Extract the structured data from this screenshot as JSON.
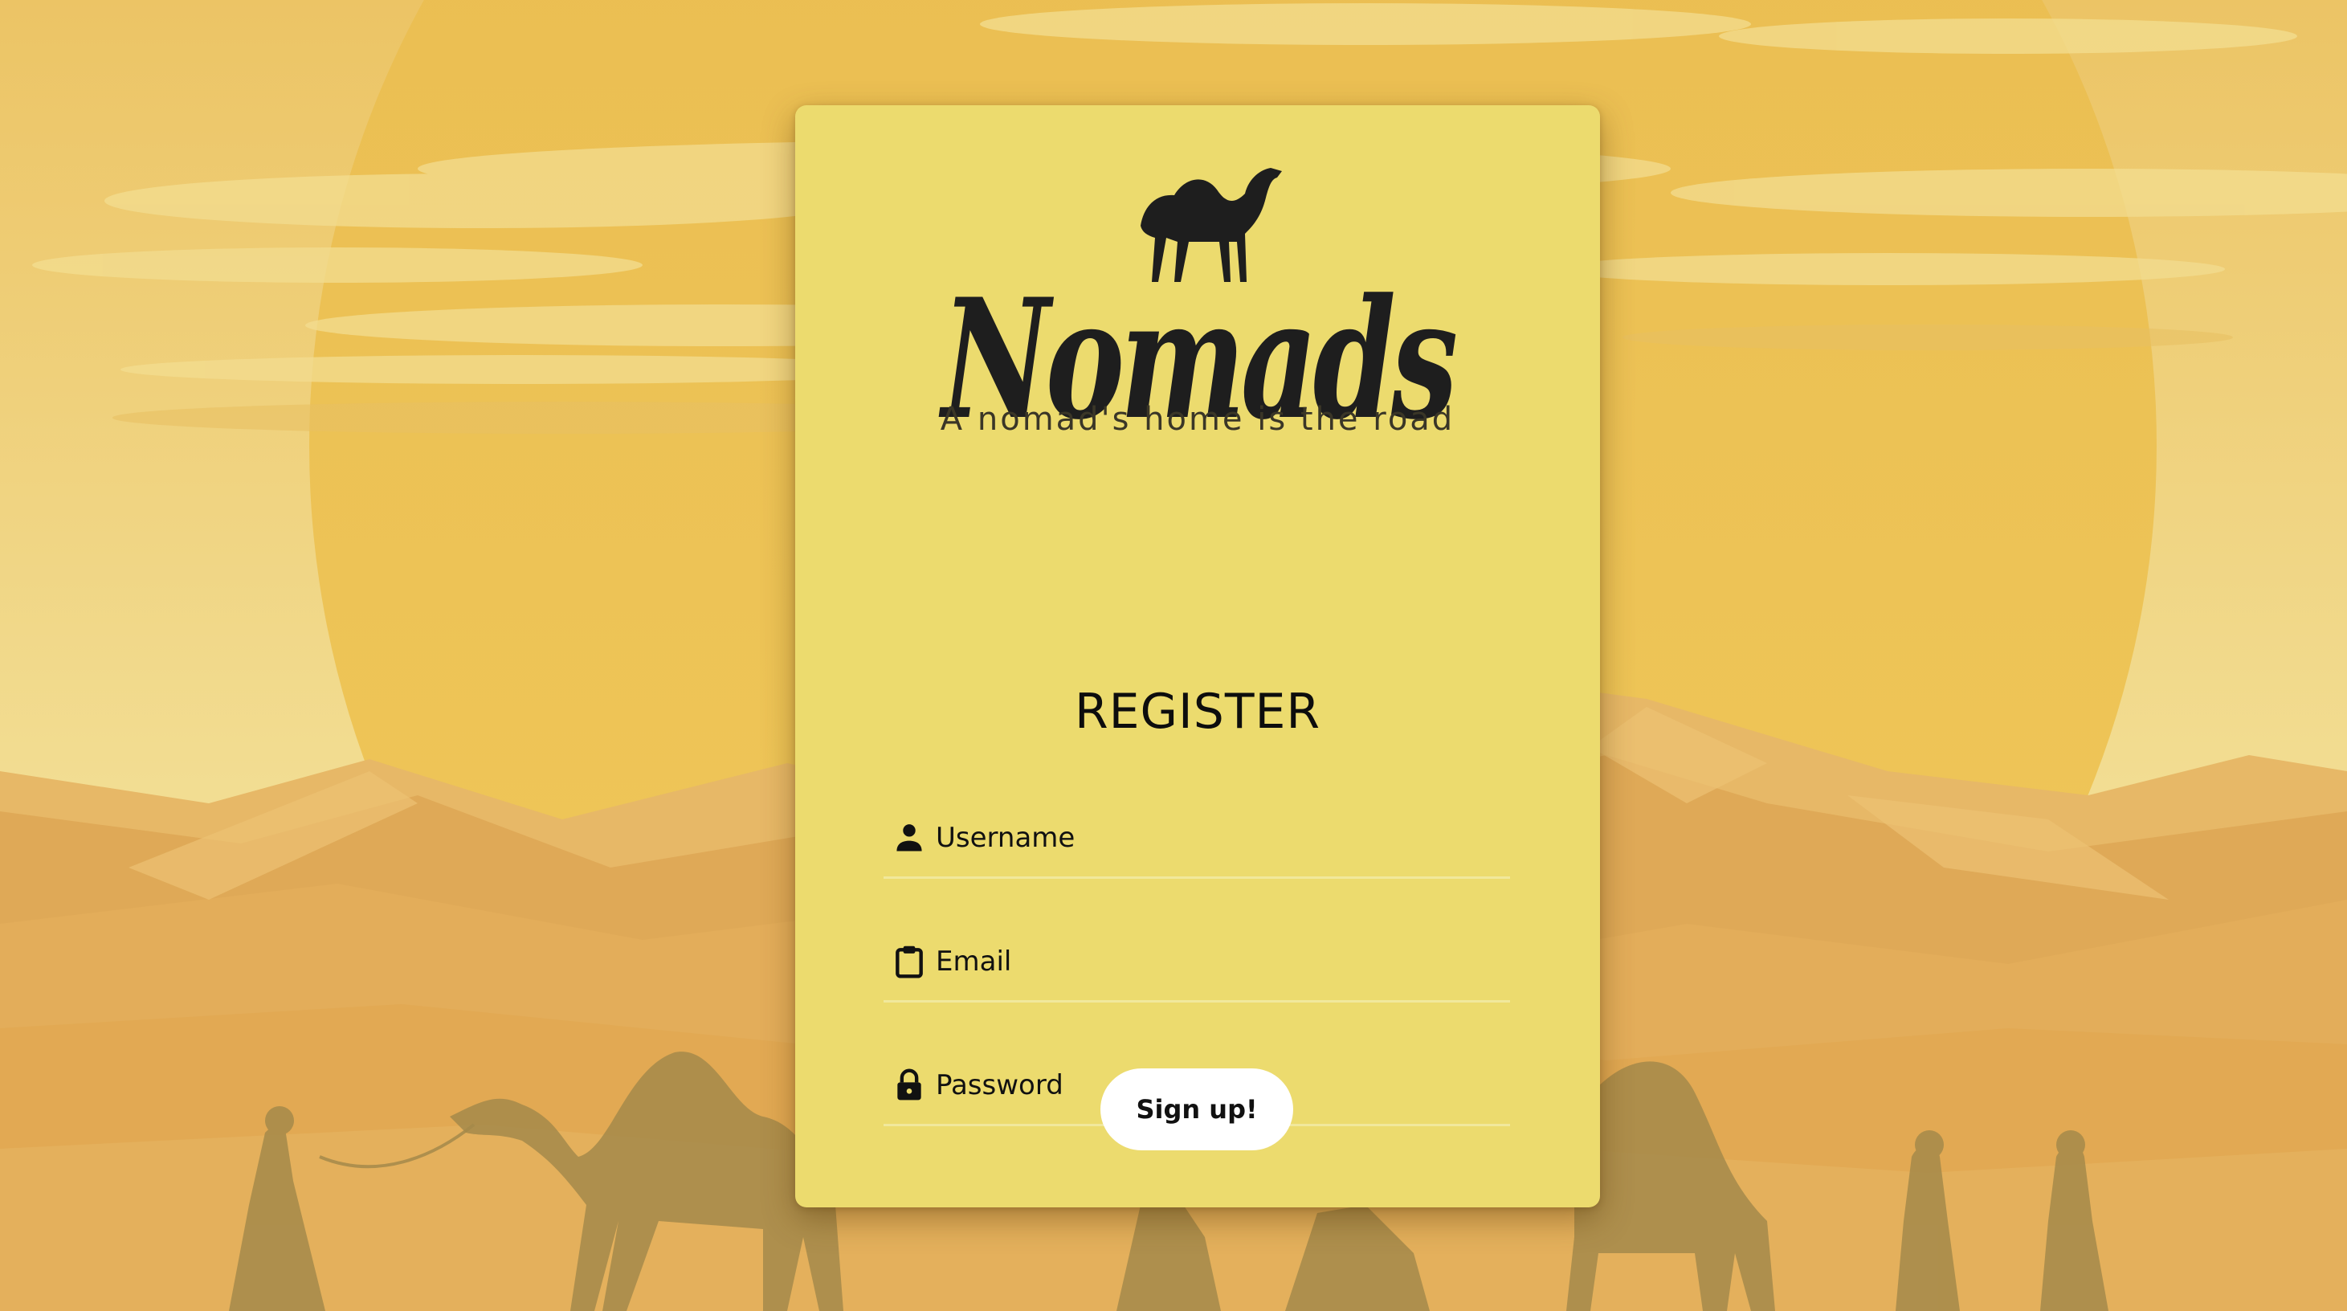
{
  "colors": {
    "card": "#ecdb6e",
    "sky_light": "#f4e6a6",
    "sun": "#ecbd52",
    "dunes": "#e3ad55",
    "silhouettes": "#a58a4a",
    "button_bg": "#ffffff",
    "text": "#111111"
  },
  "brand": {
    "name": "Nomads",
    "tagline": "A nomad's home is the road",
    "logo_icon": "camel-icon"
  },
  "register": {
    "title": "REGISTER",
    "fields": {
      "username": {
        "placeholder": "Username",
        "value": "",
        "icon": "person-icon"
      },
      "email": {
        "placeholder": "Email",
        "value": "",
        "icon": "clipboard-icon"
      },
      "password": {
        "placeholder": "Password",
        "value": "",
        "icon": "lock-icon"
      }
    },
    "submit_label": "Sign up!"
  }
}
